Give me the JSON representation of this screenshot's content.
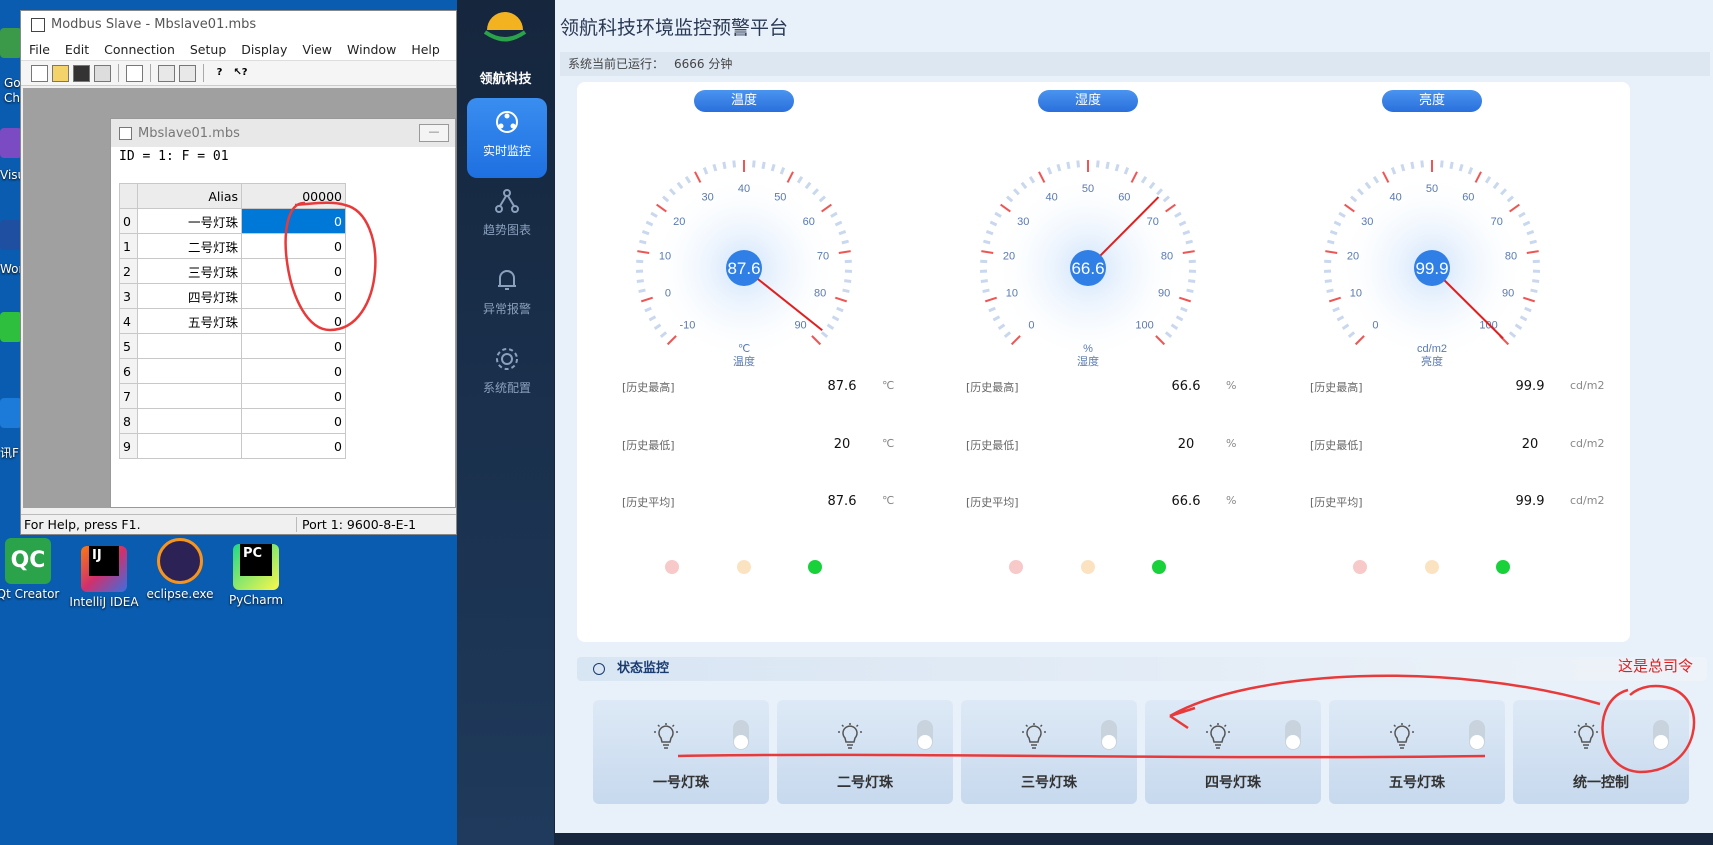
{
  "desktop": {
    "icons": [
      {
        "label": "Qt Creator",
        "color": "#2aa34a"
      },
      {
        "label": "IntelliJ IDEA",
        "color": "#d0306e"
      },
      {
        "label": "eclipse.exe",
        "color": "#2c2255"
      },
      {
        "label": "PyCharm",
        "color": "#21d789"
      }
    ],
    "edge_labels": [
      "Go",
      "Ch",
      "Visua",
      "Wor",
      "讯F"
    ]
  },
  "modbus": {
    "title": "Modbus Slave - Mbslave01.mbs",
    "menu": [
      "File",
      "Edit",
      "Connection",
      "Setup",
      "Display",
      "View",
      "Window",
      "Help"
    ],
    "child_title": "Mbslave01.mbs",
    "id_line": "ID = 1: F = 01",
    "minimize_glyph": "—",
    "col_alias": "Alias",
    "col_value": "00000",
    "rows": [
      {
        "n": "0",
        "alias": "一号灯珠",
        "value": "0"
      },
      {
        "n": "1",
        "alias": "二号灯珠",
        "value": "0"
      },
      {
        "n": "2",
        "alias": "三号灯珠",
        "value": "0"
      },
      {
        "n": "3",
        "alias": "四号灯珠",
        "value": "0"
      },
      {
        "n": "4",
        "alias": "五号灯珠",
        "value": "0"
      },
      {
        "n": "5",
        "alias": "",
        "value": "0"
      },
      {
        "n": "6",
        "alias": "",
        "value": "0"
      },
      {
        "n": "7",
        "alias": "",
        "value": "0"
      },
      {
        "n": "8",
        "alias": "",
        "value": "0"
      },
      {
        "n": "9",
        "alias": "",
        "value": "0"
      }
    ],
    "status_left": "For Help, press F1.",
    "status_port": "Port 1: 9600-8-E-1"
  },
  "dashboard": {
    "brand": "领航科技",
    "nav": [
      {
        "label": "实时监控",
        "icon": "monitor-icon",
        "active": true
      },
      {
        "label": "趋势图表",
        "icon": "trend-icon",
        "active": false
      },
      {
        "label": "异常报警",
        "icon": "bell-icon",
        "active": false
      },
      {
        "label": "系统配置",
        "icon": "gear-icon",
        "active": false
      }
    ],
    "title": "领航科技环境监控预警平台",
    "run_label": "系统当前已运行：",
    "run_value": "6666 分钟",
    "cards": [
      {
        "badge": "温度",
        "value": "87.6",
        "unit": "℃",
        "name": "温度",
        "ticks": [
          "-10",
          "0",
          "10",
          "20",
          "30",
          "40",
          "50",
          "60",
          "70",
          "80",
          "90"
        ],
        "min": -10,
        "max": 90,
        "reading": 87.6,
        "hist": [
          {
            "label": "[历史最高]",
            "value": "87.6"
          },
          {
            "label": "[历史最低]",
            "value": "20"
          },
          {
            "label": "[历史平均]",
            "value": "87.6"
          }
        ]
      },
      {
        "badge": "湿度",
        "value": "66.6",
        "unit": "%",
        "name": "湿度",
        "ticks": [
          "0",
          "10",
          "20",
          "30",
          "40",
          "50",
          "60",
          "70",
          "80",
          "90",
          "100"
        ],
        "min": 0,
        "max": 100,
        "reading": 66.6,
        "hist": [
          {
            "label": "[历史最高]",
            "value": "66.6"
          },
          {
            "label": "[历史最低]",
            "value": "20"
          },
          {
            "label": "[历史平均]",
            "value": "66.6"
          }
        ]
      },
      {
        "badge": "亮度",
        "value": "99.9",
        "unit": "cd/m2",
        "name": "亮度",
        "ticks": [
          "0",
          "10",
          "20",
          "30",
          "40",
          "50",
          "60",
          "70",
          "80",
          "90",
          "100"
        ],
        "min": 0,
        "max": 100,
        "reading": 99.9,
        "hist": [
          {
            "label": "[历史最高]",
            "value": "99.9"
          },
          {
            "label": "[历史最低]",
            "value": "20"
          },
          {
            "label": "[历史平均]",
            "value": "99.9"
          }
        ]
      }
    ],
    "led_colors": [
      "#f7c9c9",
      "#fbe3c2",
      "#19d13a"
    ],
    "status_section": "状态监控",
    "lamps": [
      "一号灯珠",
      "二号灯珠",
      "三号灯珠",
      "四号灯珠",
      "五号灯珠",
      "统一控制"
    ]
  },
  "annotation": {
    "text": "这是总司令",
    "color": "#e02020"
  }
}
